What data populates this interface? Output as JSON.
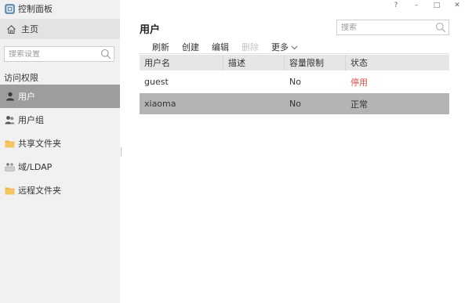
{
  "app": {
    "title": "控制面板"
  },
  "window_controls": {
    "help": "?",
    "minimize": "–",
    "maximize": "□",
    "close": "✕"
  },
  "sidebar": {
    "home_label": "主页",
    "search_placeholder": "搜索设置",
    "section_title": "访问权限",
    "items": [
      {
        "label": "用户",
        "icon": "user-icon",
        "active": true
      },
      {
        "label": "用户组",
        "icon": "user-group-icon",
        "active": false
      },
      {
        "label": "共享文件夹",
        "icon": "folder-icon",
        "active": false
      },
      {
        "label": "域/LDAP",
        "icon": "ldap-icon",
        "active": false
      },
      {
        "label": "远程文件夹",
        "icon": "folder-icon",
        "active": false
      }
    ]
  },
  "main": {
    "title": "用户",
    "search_placeholder": "搜索",
    "toolbar": {
      "refresh": "刷新",
      "create": "创建",
      "edit": "编辑",
      "delete": "删除",
      "more": "更多"
    },
    "table": {
      "columns": [
        "用户名",
        "描述",
        "容量限制",
        "状态"
      ],
      "rows": [
        {
          "name": "guest",
          "description": "",
          "quota": "No",
          "status": "停用",
          "status_kind": "disabled"
        },
        {
          "name": "xiaoma",
          "description": "",
          "quota": "No",
          "status": "正常",
          "status_kind": "normal"
        }
      ]
    }
  },
  "colors": {
    "sidebar_bg": "#f1f1f1",
    "active_item_bg": "#9d9d9d",
    "selected_row_bg": "#b4b4b4",
    "status_disabled": "#d9534f",
    "folder": "#f0b84a"
  }
}
